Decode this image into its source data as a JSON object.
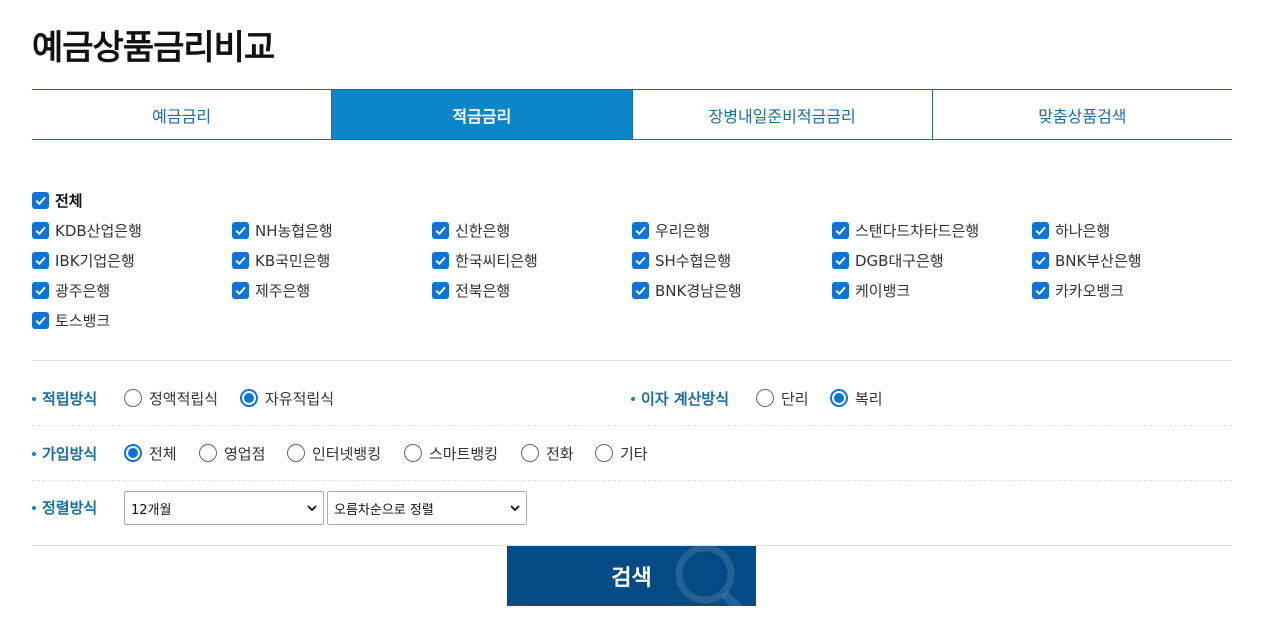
{
  "page": {
    "title": "예금상품금리비교"
  },
  "tabs": [
    {
      "label": "예금금리",
      "active": false
    },
    {
      "label": "적금금리",
      "active": true
    },
    {
      "label": "장병내일준비적금금리",
      "active": false
    },
    {
      "label": "맞춤상품검색",
      "active": false
    }
  ],
  "banks": {
    "all_label": "전체",
    "items": [
      "KDB산업은행",
      "NH농협은행",
      "신한은행",
      "우리은행",
      "스탠다드차타드은행",
      "하나은행",
      "IBK기업은행",
      "KB국민은행",
      "한국씨티은행",
      "SH수협은행",
      "DGB대구은행",
      "BNK부산은행",
      "광주은행",
      "제주은행",
      "전북은행",
      "BNK경남은행",
      "케이뱅크",
      "카카오뱅크",
      "토스뱅크"
    ],
    "checked": true
  },
  "saving_method": {
    "label": "적립방식",
    "options": [
      "정액적립식",
      "자유적립식"
    ],
    "selected": "자유적립식"
  },
  "interest_method": {
    "label": "이자 계산방식",
    "options": [
      "단리",
      "복리"
    ],
    "selected": "복리"
  },
  "join_method": {
    "label": "가입방식",
    "options": [
      "전체",
      "영업점",
      "인터넷뱅킹",
      "스마트뱅킹",
      "전화",
      "기타"
    ],
    "selected": "전체"
  },
  "sort": {
    "label": "정렬방식",
    "period_value": "12개월",
    "order_value": "오름차순으로 정렬"
  },
  "search_button": {
    "label": "검색"
  },
  "colors": {
    "primary": "#0a87c9",
    "dark_button": "#034b85",
    "accent_text": "#1a6e9e",
    "check": "#0b74d6"
  },
  "icons": [
    "check-icon",
    "chevron-down-icon",
    "search-icon"
  ]
}
